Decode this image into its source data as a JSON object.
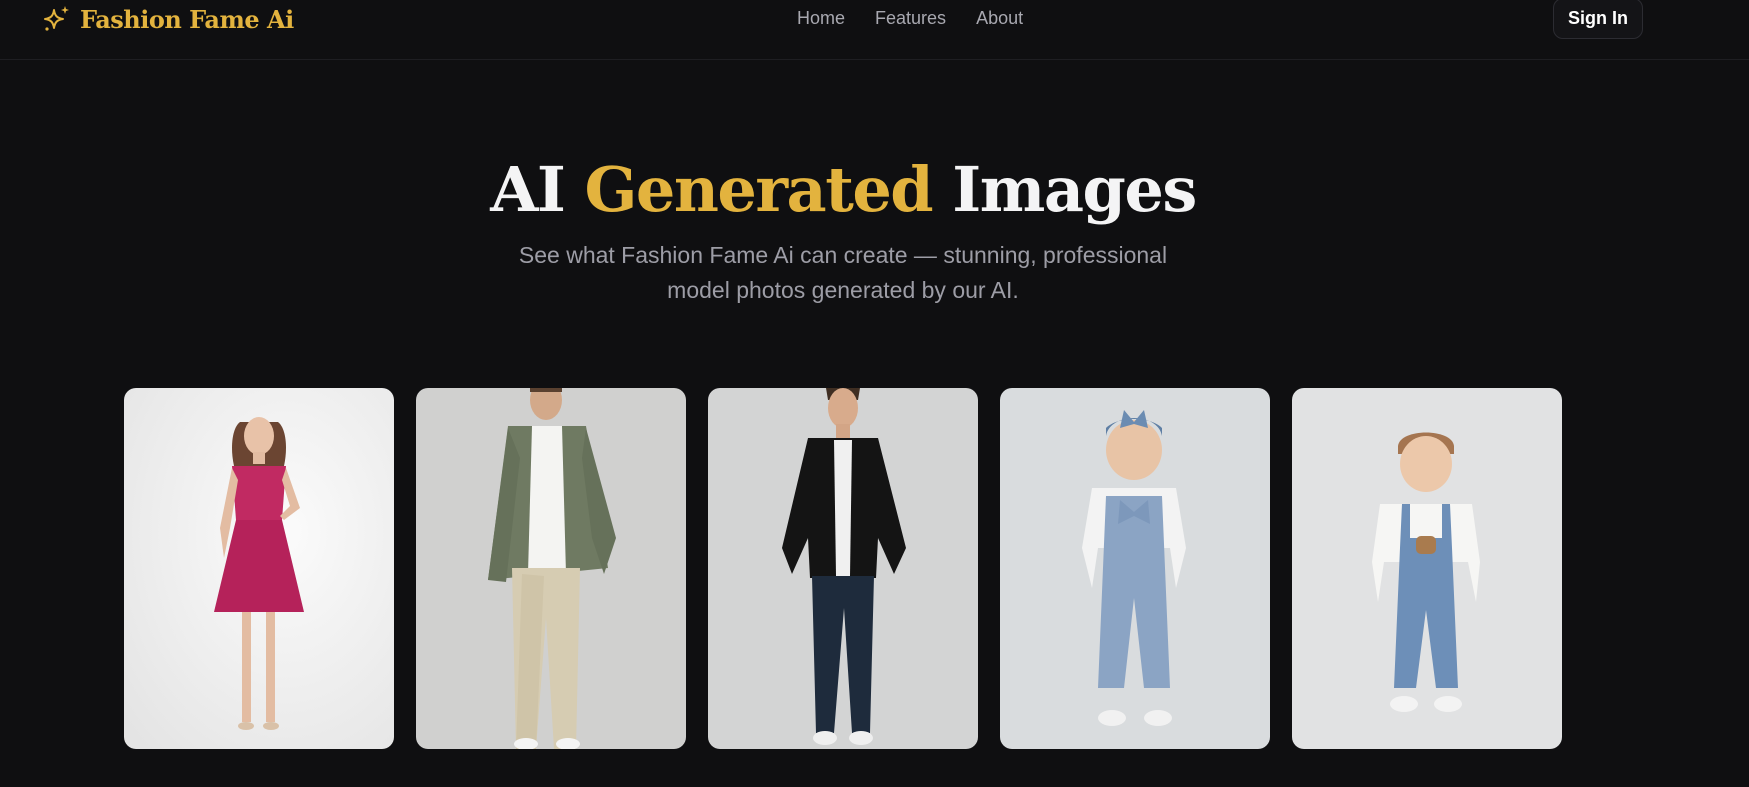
{
  "brand": {
    "name": "Fashion Fame Ai",
    "icon": "sparkle-icon",
    "color": "#e3b33e"
  },
  "nav": {
    "links": [
      "Home",
      "Features",
      "About"
    ]
  },
  "auth": {
    "signin_label": "Sign In"
  },
  "hero": {
    "title_part1": "AI ",
    "title_accent": "Generated",
    "title_part2": " Images",
    "subtitle_line1": "See what Fashion Fame Ai can create — stunning, professional",
    "subtitle_line2": "model photos generated by our AI."
  },
  "gallery": {
    "items": [
      {
        "name": "woman-pink-dress"
      },
      {
        "name": "man-green-jacket"
      },
      {
        "name": "man-black-shirt"
      },
      {
        "name": "toddler-girl-denim"
      },
      {
        "name": "toddler-boy-overalls"
      }
    ]
  },
  "colors": {
    "background": "#0f0f11",
    "accent": "#e3b33e",
    "muted": "#9d9da6"
  }
}
